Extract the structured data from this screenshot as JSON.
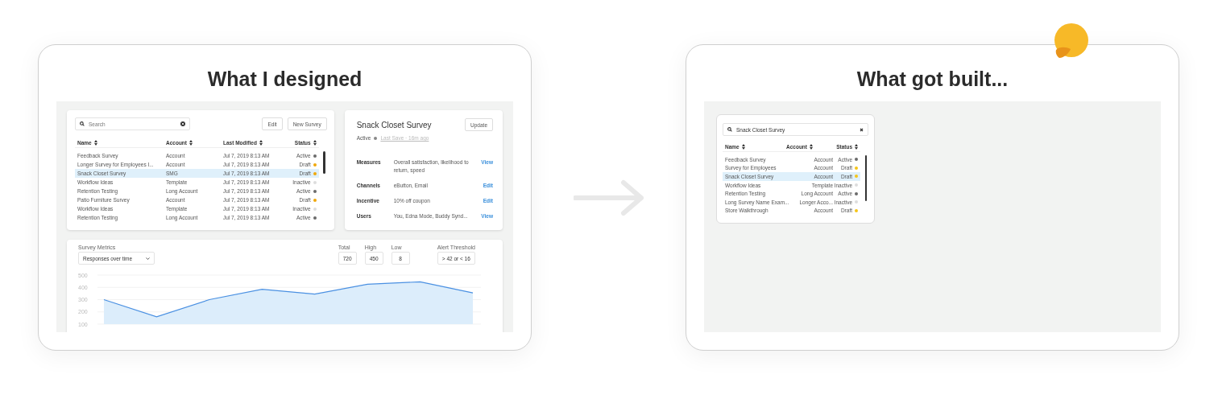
{
  "designed": {
    "title": "What I designed",
    "survey_list": {
      "search": {
        "placeholder": "Search"
      },
      "buttons": [
        "Edit",
        "New Survey"
      ],
      "columns": [
        "Name",
        "Account",
        "Last Modified",
        "Status"
      ],
      "rows": [
        {
          "name": "Feedback Survey",
          "account": "Account",
          "modified": "Jul 7, 2019 8:13 AM",
          "status": "Active",
          "color": "#6b6b6b",
          "selected": false
        },
        {
          "name": "Longer Survey for Employees I...",
          "account": "Account",
          "modified": "Jul 7, 2019 8:13 AM",
          "status": "Draft",
          "color": "#f0a80c",
          "selected": false
        },
        {
          "name": "Snack Closet Survey",
          "account": "SMG",
          "modified": "Jul 7, 2019 8:13 AM",
          "status": "Draft",
          "color": "#f0a80c",
          "selected": true
        },
        {
          "name": "Workflow Ideas",
          "account": "Template",
          "modified": "Jul 7, 2019 8:13 AM",
          "status": "Inactive",
          "color": "#dddddd",
          "selected": false
        },
        {
          "name": "Retention Testing",
          "account": "Long Account",
          "modified": "Jul 7, 2019 8:13 AM",
          "status": "Active",
          "color": "#6b6b6b",
          "selected": false
        },
        {
          "name": "Patio Furniture Survey",
          "account": "Account",
          "modified": "Jul 7, 2019 8:13 AM",
          "status": "Draft",
          "color": "#f0a80c",
          "selected": false
        },
        {
          "name": "Workflow Ideas",
          "account": "Template",
          "modified": "Jul 7, 2019 8:13 AM",
          "status": "Inactive",
          "color": "#dddddd",
          "selected": false
        },
        {
          "name": "Retention Testing",
          "account": "Long Account",
          "modified": "Jul 7, 2019 8:13 AM",
          "status": "Active",
          "color": "#6b6b6b",
          "selected": false
        }
      ]
    },
    "detail": {
      "title": "Snack Closet Survey",
      "button": "Update",
      "status": "Active",
      "last_save": "Last Save  ·  16m ago",
      "fields": [
        {
          "label": "Measures",
          "value": "Overall satisfaction, likelihood to return, speed",
          "action": "View"
        },
        {
          "label": "Channels",
          "value": "eButton, Email",
          "action": "Edit"
        },
        {
          "label": "Incentive",
          "value": "10% off coupon",
          "action": "Edit"
        },
        {
          "label": "Users",
          "value": "You, Edna Mode, Buddy Synd...",
          "action": "View"
        }
      ]
    },
    "metrics": {
      "label": "Survey Metrics",
      "select": {
        "value": "Responses over time"
      },
      "stats": [
        {
          "label": "Total",
          "value": "720"
        },
        {
          "label": "High",
          "value": "450"
        },
        {
          "label": "Low",
          "value": "8"
        },
        {
          "label": "Alert Threshold",
          "value": "> 42 or < 16"
        }
      ],
      "chart_data": {
        "type": "area",
        "values": [
          300,
          160,
          300,
          385,
          345,
          425,
          445,
          355
        ],
        "ylim": [
          100,
          500
        ],
        "yticks": [
          100,
          200,
          300,
          400,
          500
        ],
        "grid": true
      }
    }
  },
  "built": {
    "title": "What got built...",
    "survey_list": {
      "search": {
        "value": "Snack Closet Survey"
      },
      "columns": [
        "Name",
        "Account",
        "Status"
      ],
      "rows": [
        {
          "name": "Feedback Survey",
          "account": "Account",
          "status": "Active",
          "color": "#6b6b6b",
          "selected": false
        },
        {
          "name": "Survey for Employees",
          "account": "Account",
          "status": "Draft",
          "color": "#f5c518",
          "selected": false
        },
        {
          "name": "Snack Closet Survey",
          "account": "Account",
          "status": "Draft",
          "color": "#f5c518",
          "selected": true
        },
        {
          "name": "Workflow Ideas",
          "account": "Template",
          "status": "Inactive",
          "color": "#dddddd",
          "selected": false
        },
        {
          "name": "Retention Testing",
          "account": "Long Account",
          "status": "Active",
          "color": "#6b6b6b",
          "selected": false
        },
        {
          "name": "Long Survey Name Exam...",
          "account": "Longer Acco...",
          "status": "Inactive",
          "color": "#dddddd",
          "selected": false
        },
        {
          "name": "Store Walkthrough",
          "account": "Account",
          "status": "Draft",
          "color": "#f5c518",
          "selected": false
        }
      ]
    }
  }
}
